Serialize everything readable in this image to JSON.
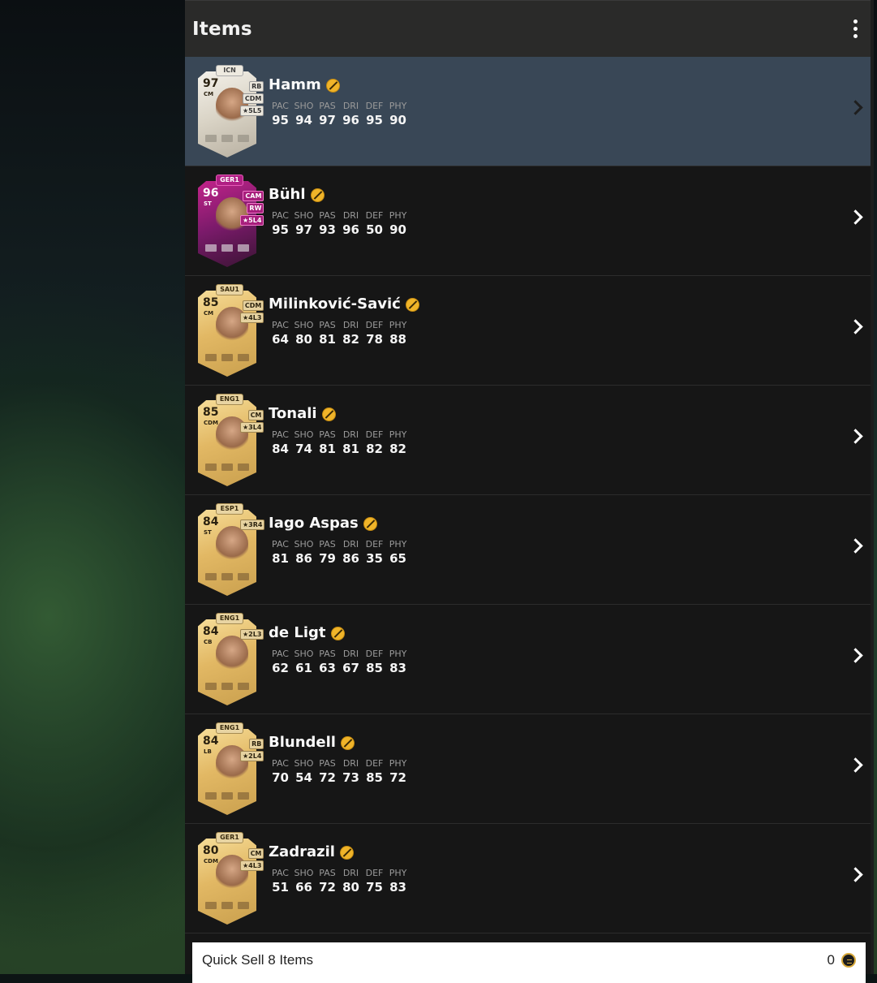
{
  "header": {
    "title": "Items"
  },
  "stat_labels": [
    "PAC",
    "SHO",
    "PAS",
    "DRI",
    "DEF",
    "PHY"
  ],
  "items": [
    {
      "name": "Hamm",
      "rating": "97",
      "position": "CM",
      "league": "ICN",
      "alt_positions": [
        "RB",
        "CDM"
      ],
      "skill": "★5L5",
      "card_style": "icon",
      "selected": true,
      "stats": [
        "95",
        "94",
        "97",
        "96",
        "95",
        "90"
      ]
    },
    {
      "name": "Bühl",
      "rating": "96",
      "position": "ST",
      "league": "GER1",
      "alt_positions": [
        "CAM",
        "RW"
      ],
      "skill": "★5L4",
      "card_style": "pink",
      "selected": false,
      "stats": [
        "95",
        "97",
        "93",
        "96",
        "50",
        "90"
      ]
    },
    {
      "name": "Milinković-Savić",
      "rating": "85",
      "position": "CM",
      "league": "SAU1",
      "alt_positions": [
        "CDM"
      ],
      "skill": "★4L3",
      "card_style": "gold",
      "selected": false,
      "stats": [
        "64",
        "80",
        "81",
        "82",
        "78",
        "88"
      ]
    },
    {
      "name": "Tonali",
      "rating": "85",
      "position": "CDM",
      "league": "ENG1",
      "alt_positions": [
        "CM"
      ],
      "skill": "★3L4",
      "card_style": "gold",
      "selected": false,
      "stats": [
        "84",
        "74",
        "81",
        "81",
        "82",
        "82"
      ]
    },
    {
      "name": "Iago Aspas",
      "rating": "84",
      "position": "ST",
      "league": "ESP1",
      "alt_positions": [],
      "skill": "★3R4",
      "card_style": "gold",
      "selected": false,
      "stats": [
        "81",
        "86",
        "79",
        "86",
        "35",
        "65"
      ]
    },
    {
      "name": "de Ligt",
      "rating": "84",
      "position": "CB",
      "league": "ENG1",
      "alt_positions": [],
      "skill": "★2L3",
      "card_style": "gold",
      "selected": false,
      "stats": [
        "62",
        "61",
        "63",
        "67",
        "85",
        "83"
      ]
    },
    {
      "name": "Blundell",
      "rating": "84",
      "position": "LB",
      "league": "ENG1",
      "alt_positions": [
        "RB"
      ],
      "skill": "★2L4",
      "card_style": "gold",
      "selected": false,
      "stats": [
        "70",
        "54",
        "72",
        "73",
        "85",
        "72"
      ]
    },
    {
      "name": "Zadrazil",
      "rating": "80",
      "position": "CDM",
      "league": "GER1",
      "alt_positions": [
        "CM"
      ],
      "skill": "★4L3",
      "card_style": "gold",
      "selected": false,
      "stats": [
        "51",
        "66",
        "72",
        "80",
        "75",
        "83"
      ]
    }
  ],
  "quick_sell": {
    "label": "Quick Sell 8 Items",
    "value": "0",
    "icon": "coin-icon"
  },
  "colors": {
    "panel_bg": "#161616",
    "header_bg": "#2a2a29",
    "selected_row": "#394756",
    "untradeable": "#f0b429"
  }
}
